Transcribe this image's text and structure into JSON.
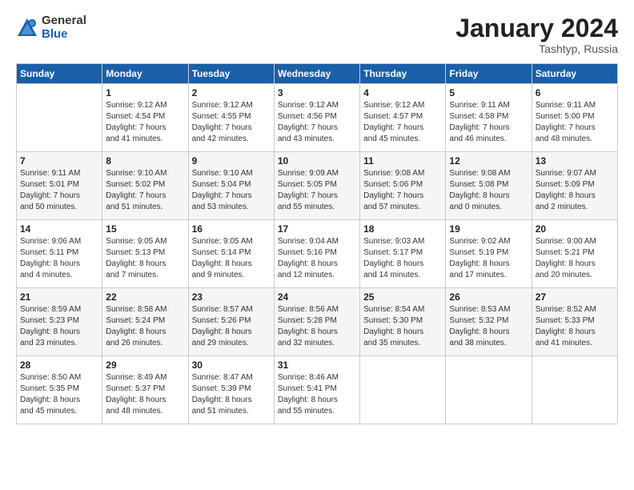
{
  "logo": {
    "general": "General",
    "blue": "Blue"
  },
  "title": "January 2024",
  "location": "Tashtyp, Russia",
  "days_of_week": [
    "Sunday",
    "Monday",
    "Tuesday",
    "Wednesday",
    "Thursday",
    "Friday",
    "Saturday"
  ],
  "weeks": [
    [
      {
        "day": "",
        "info": ""
      },
      {
        "day": "1",
        "info": "Sunrise: 9:12 AM\nSunset: 4:54 PM\nDaylight: 7 hours\nand 41 minutes."
      },
      {
        "day": "2",
        "info": "Sunrise: 9:12 AM\nSunset: 4:55 PM\nDaylight: 7 hours\nand 42 minutes."
      },
      {
        "day": "3",
        "info": "Sunrise: 9:12 AM\nSunset: 4:56 PM\nDaylight: 7 hours\nand 43 minutes."
      },
      {
        "day": "4",
        "info": "Sunrise: 9:12 AM\nSunset: 4:57 PM\nDaylight: 7 hours\nand 45 minutes."
      },
      {
        "day": "5",
        "info": "Sunrise: 9:11 AM\nSunset: 4:58 PM\nDaylight: 7 hours\nand 46 minutes."
      },
      {
        "day": "6",
        "info": "Sunrise: 9:11 AM\nSunset: 5:00 PM\nDaylight: 7 hours\nand 48 minutes."
      }
    ],
    [
      {
        "day": "7",
        "info": "Sunrise: 9:11 AM\nSunset: 5:01 PM\nDaylight: 7 hours\nand 50 minutes."
      },
      {
        "day": "8",
        "info": "Sunrise: 9:10 AM\nSunset: 5:02 PM\nDaylight: 7 hours\nand 51 minutes."
      },
      {
        "day": "9",
        "info": "Sunrise: 9:10 AM\nSunset: 5:04 PM\nDaylight: 7 hours\nand 53 minutes."
      },
      {
        "day": "10",
        "info": "Sunrise: 9:09 AM\nSunset: 5:05 PM\nDaylight: 7 hours\nand 55 minutes."
      },
      {
        "day": "11",
        "info": "Sunrise: 9:08 AM\nSunset: 5:06 PM\nDaylight: 7 hours\nand 57 minutes."
      },
      {
        "day": "12",
        "info": "Sunrise: 9:08 AM\nSunset: 5:08 PM\nDaylight: 8 hours\nand 0 minutes."
      },
      {
        "day": "13",
        "info": "Sunrise: 9:07 AM\nSunset: 5:09 PM\nDaylight: 8 hours\nand 2 minutes."
      }
    ],
    [
      {
        "day": "14",
        "info": "Sunrise: 9:06 AM\nSunset: 5:11 PM\nDaylight: 8 hours\nand 4 minutes."
      },
      {
        "day": "15",
        "info": "Sunrise: 9:05 AM\nSunset: 5:13 PM\nDaylight: 8 hours\nand 7 minutes."
      },
      {
        "day": "16",
        "info": "Sunrise: 9:05 AM\nSunset: 5:14 PM\nDaylight: 8 hours\nand 9 minutes."
      },
      {
        "day": "17",
        "info": "Sunrise: 9:04 AM\nSunset: 5:16 PM\nDaylight: 8 hours\nand 12 minutes."
      },
      {
        "day": "18",
        "info": "Sunrise: 9:03 AM\nSunset: 5:17 PM\nDaylight: 8 hours\nand 14 minutes."
      },
      {
        "day": "19",
        "info": "Sunrise: 9:02 AM\nSunset: 5:19 PM\nDaylight: 8 hours\nand 17 minutes."
      },
      {
        "day": "20",
        "info": "Sunrise: 9:00 AM\nSunset: 5:21 PM\nDaylight: 8 hours\nand 20 minutes."
      }
    ],
    [
      {
        "day": "21",
        "info": "Sunrise: 8:59 AM\nSunset: 5:23 PM\nDaylight: 8 hours\nand 23 minutes."
      },
      {
        "day": "22",
        "info": "Sunrise: 8:58 AM\nSunset: 5:24 PM\nDaylight: 8 hours\nand 26 minutes."
      },
      {
        "day": "23",
        "info": "Sunrise: 8:57 AM\nSunset: 5:26 PM\nDaylight: 8 hours\nand 29 minutes."
      },
      {
        "day": "24",
        "info": "Sunrise: 8:56 AM\nSunset: 5:28 PM\nDaylight: 8 hours\nand 32 minutes."
      },
      {
        "day": "25",
        "info": "Sunrise: 8:54 AM\nSunset: 5:30 PM\nDaylight: 8 hours\nand 35 minutes."
      },
      {
        "day": "26",
        "info": "Sunrise: 8:53 AM\nSunset: 5:32 PM\nDaylight: 8 hours\nand 38 minutes."
      },
      {
        "day": "27",
        "info": "Sunrise: 8:52 AM\nSunset: 5:33 PM\nDaylight: 8 hours\nand 41 minutes."
      }
    ],
    [
      {
        "day": "28",
        "info": "Sunrise: 8:50 AM\nSunset: 5:35 PM\nDaylight: 8 hours\nand 45 minutes."
      },
      {
        "day": "29",
        "info": "Sunrise: 8:49 AM\nSunset: 5:37 PM\nDaylight: 8 hours\nand 48 minutes."
      },
      {
        "day": "30",
        "info": "Sunrise: 8:47 AM\nSunset: 5:39 PM\nDaylight: 8 hours\nand 51 minutes."
      },
      {
        "day": "31",
        "info": "Sunrise: 8:46 AM\nSunset: 5:41 PM\nDaylight: 8 hours\nand 55 minutes."
      },
      {
        "day": "",
        "info": ""
      },
      {
        "day": "",
        "info": ""
      },
      {
        "day": "",
        "info": ""
      }
    ]
  ]
}
